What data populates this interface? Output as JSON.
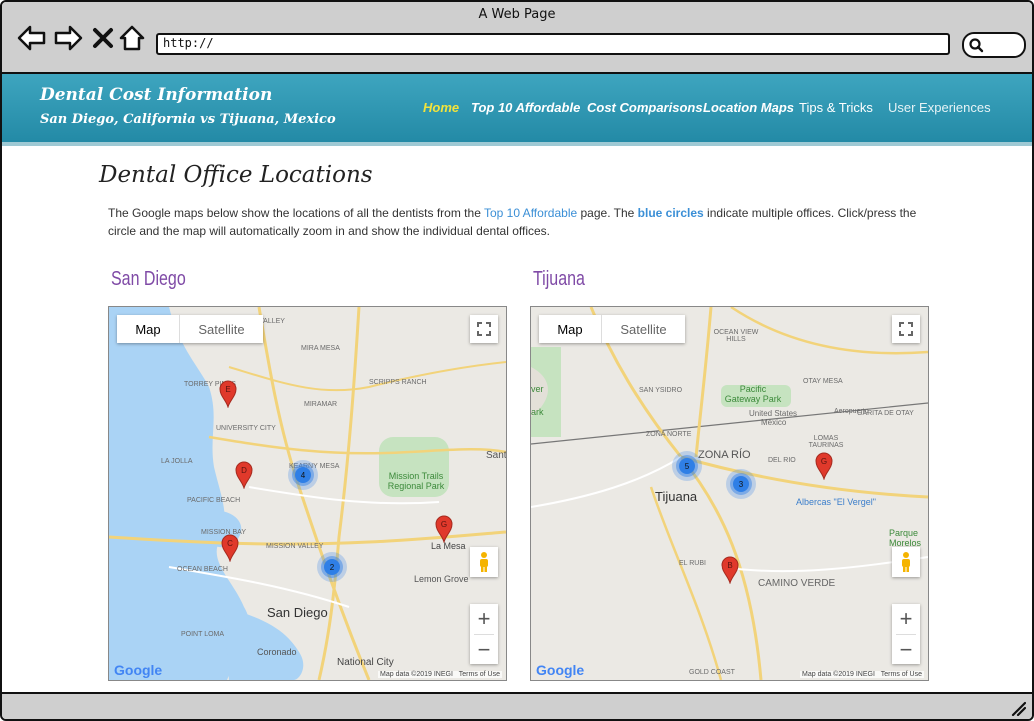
{
  "window": {
    "title": "A Web Page",
    "url": "http://"
  },
  "site": {
    "title": "Dental Cost Information",
    "subtitle": "San Diego, California vs Tijuana, Mexico",
    "nav": [
      "Home",
      "Top 10 Affordable",
      "Cost Comparisons",
      "Location Maps",
      "Tips & Tricks",
      "User Experiences"
    ]
  },
  "page": {
    "heading": "Dental Office Locations",
    "intro": {
      "p1": "The Google maps below show the locations of all the dentists from the ",
      "link1": "Top 10 Affordable",
      "p2": " page. The ",
      "link2": "blue circles",
      "p3": " indicate multiple offices. Click/press the circle and the map will automatically zoom in and show the individual dental offices."
    }
  },
  "maps": [
    {
      "title": "San Diego",
      "map_label": "Map",
      "satellite_label": "Satellite",
      "attribution": "Map data ©2019 INEGI",
      "terms": "Terms of Use",
      "logo": "Google",
      "pins": [
        "E",
        "D",
        "C",
        "G"
      ],
      "clusters": [
        "4",
        "2"
      ],
      "labels": [
        "VALLEY",
        "MIRA MESA",
        "TORREY PINES",
        "SCRIPPS RANCH",
        "MIRAMAR",
        "UNIVERSITY CITY",
        "LA JOLLA",
        "KEARNY MESA",
        "Mission Trails Regional Park",
        "PACIFIC BEACH",
        "MISSION BAY",
        "MISSION VALLEY",
        "OCEAN BEACH",
        "La Mesa",
        "Lemon Grove",
        "San Diego",
        "POINT LOMA",
        "Coronado",
        "National City",
        "Sant"
      ]
    },
    {
      "title": "Tijuana",
      "map_label": "Map",
      "satellite_label": "Satellite",
      "attribution": "Map data ©2019 INEGI",
      "terms": "Terms of Use",
      "logo": "Google",
      "pins": [
        "G",
        "B"
      ],
      "clusters": [
        "5",
        "3"
      ],
      "labels": [
        "OCEAN VIEW HILLS",
        "OTAY MESA",
        "SAN YSIDRO",
        "Pacific Gateway Park",
        "United States",
        "México",
        "Aeropuerto",
        "GARITA DE OTAY",
        "ZONA NORTE",
        "ZONA RÍO",
        "LOMAS TAURINAS",
        "DEL RIO",
        "Tijuana",
        "Albercas \"El Vergel\"",
        "Parque Morelos",
        "EL RUBI",
        "CAMINO VERDE",
        "GOLD COAST",
        "ver",
        "ark"
      ]
    }
  ],
  "colors": {
    "header": "#2f97b2",
    "nav_active": "#f2e33b",
    "link": "#3b8fd6",
    "map_title": "#7f4aa6",
    "pin": "#e0392b",
    "cluster": "#2f7fe6"
  }
}
